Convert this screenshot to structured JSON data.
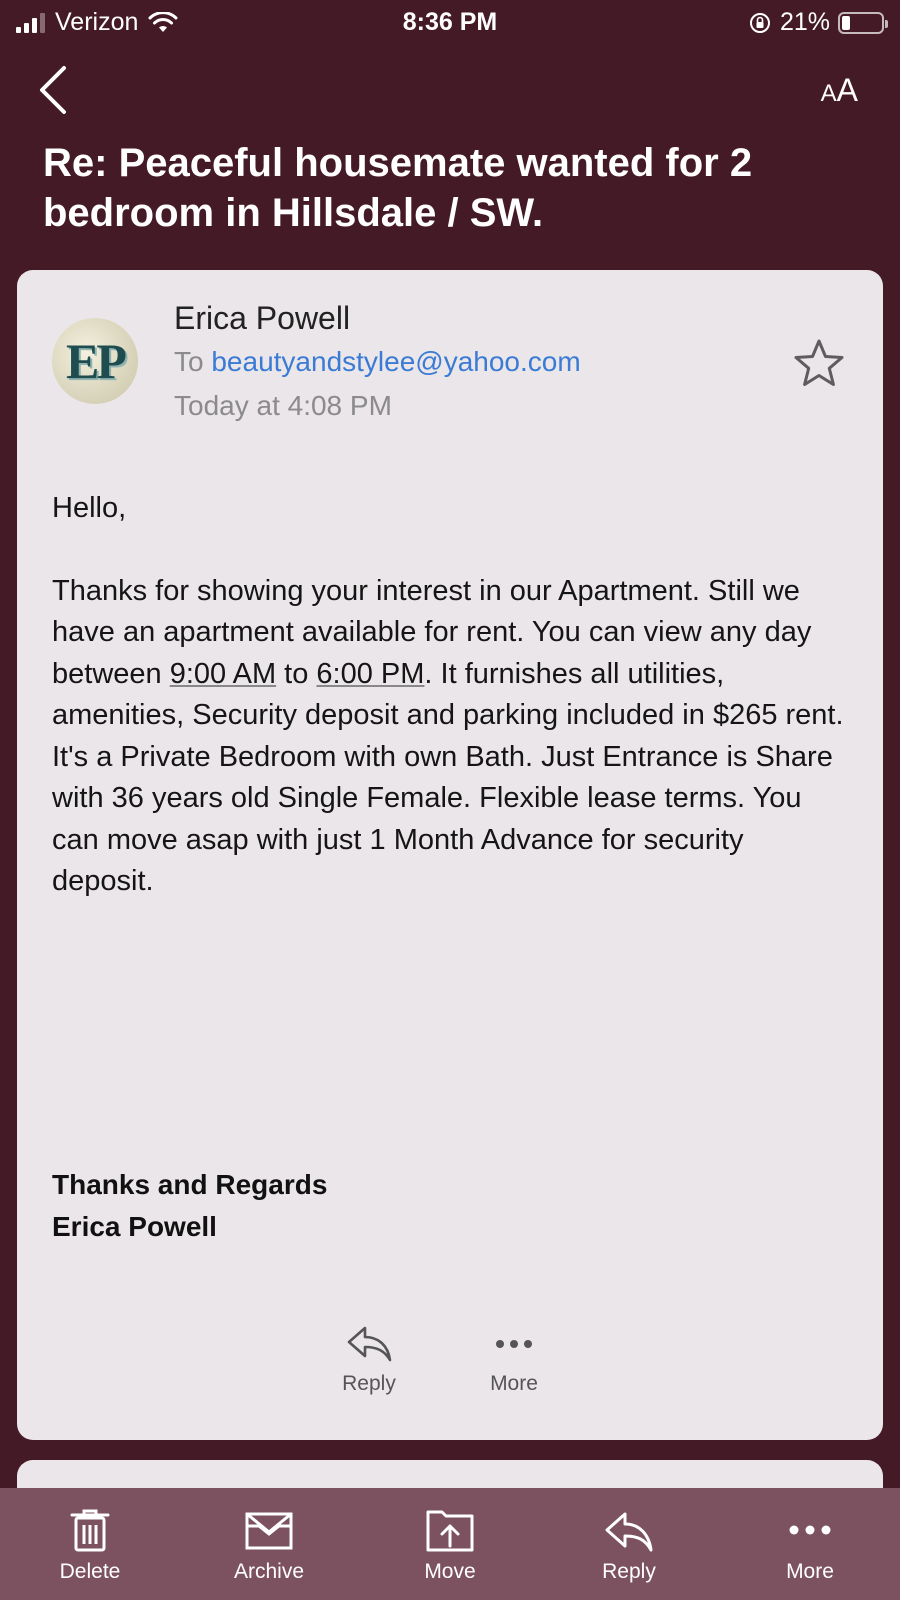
{
  "status": {
    "carrier": "Verizon",
    "time": "8:36 PM",
    "battery_percent": "21%",
    "battery_level": 0.21
  },
  "nav": {
    "back_icon": "chevron-left-icon",
    "text_size_small": "A",
    "text_size_big": "A"
  },
  "subject": "Re: Peaceful housemate wanted for 2 bedroom in Hillsdale / SW.",
  "message": {
    "avatar_initials": "EP",
    "sender_name": "Erica Powell",
    "to_prefix": "To",
    "recipient": "beautyandstylee@yahoo.com",
    "date": "Today at 4:08 PM",
    "greeting": "Hello,",
    "body_1": "Thanks for showing your interest in our Apartment. Still we have an apartment available for rent. You can view any day between ",
    "time_from": "9:00 AM",
    "body_2": " to ",
    "time_to": "6:00 PM",
    "body_3": ". It furnishes all utilities, amenities, Security deposit and parking  included in $265 rent. It's a Private Bedroom with own Bath. Just Entrance is Share with 36 years old Single Female. Flexible lease terms. You can move asap with just 1 Month Advance for security deposit.",
    "signature_line1": "Thanks and Regards",
    "signature_line2": "Erica Powell"
  },
  "card_actions": {
    "reply_label": "Reply",
    "more_label": "More"
  },
  "toolbar": {
    "delete_label": "Delete",
    "archive_label": "Archive",
    "move_label": "Move",
    "reply_label": "Reply",
    "more_label": "More"
  },
  "colors": {
    "background": "#451a27",
    "card": "#ebe6e9",
    "toolbar": "#7c5160",
    "link": "#3a7bd5"
  }
}
